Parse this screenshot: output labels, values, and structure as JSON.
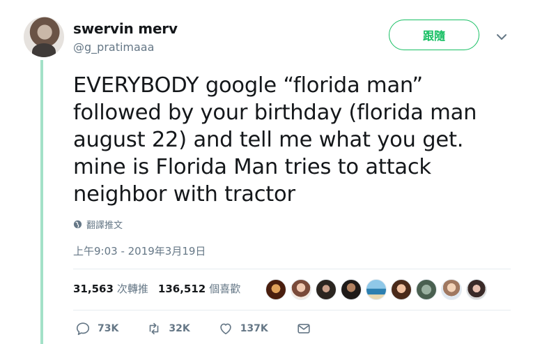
{
  "tweet": {
    "author": {
      "name": "swervin merv",
      "handle": "@g_pratimaaa"
    },
    "follow_label": "跟隨",
    "text_lines": [
      "EVERYBODY google “florida man”",
      "followed by your birthday (florida man",
      "august 22) and tell me what you get.",
      "mine is Florida Man tries to attack",
      "neighbor with tractor"
    ],
    "translate_label": "翻譯推文",
    "timestamp": "上午9:03 - 2019年3月19日",
    "stats": {
      "retweets": {
        "count": "31,563",
        "label": "次轉推"
      },
      "likes": {
        "count": "136,512",
        "label": "個喜歡"
      }
    },
    "actions": {
      "replies": "73K",
      "retweets": "32K",
      "likes": "137K"
    }
  },
  "colors": {
    "accent": "#17bf63",
    "thread_line": "#a3e1c8",
    "secondary_text": "#657786",
    "divider": "#e6ecf0"
  },
  "icons": [
    "chevron-down-icon",
    "globe-icon",
    "reply-icon",
    "retweet-icon",
    "heart-icon",
    "message-icon"
  ]
}
